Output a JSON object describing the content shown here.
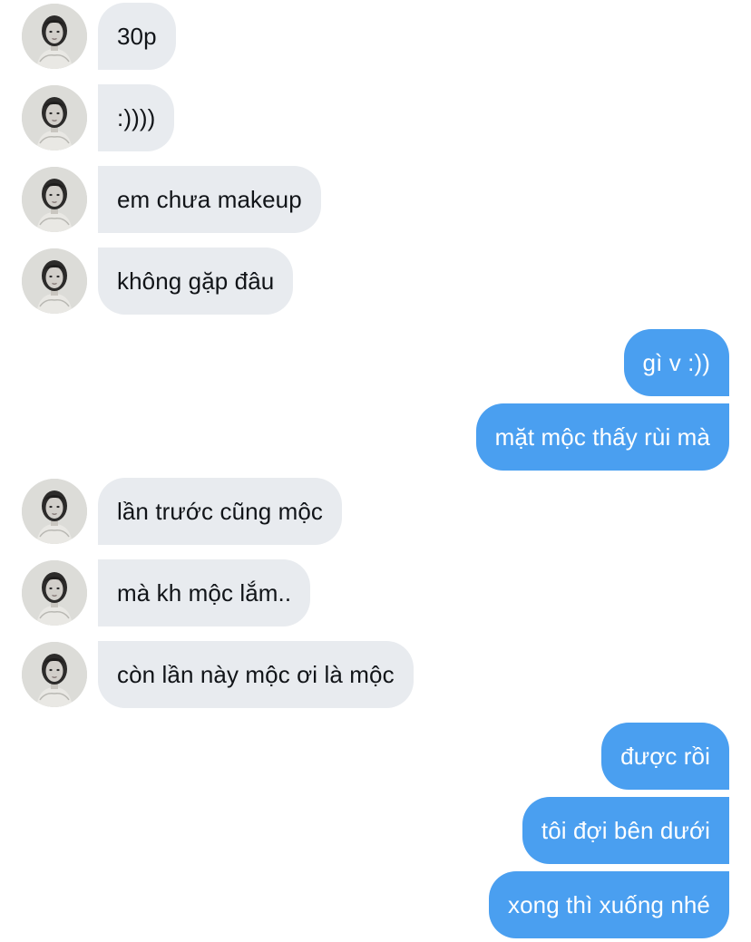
{
  "avatar_icon": "contact-portrait-icon",
  "colors": {
    "incoming_bubble": "#e8ebef",
    "outgoing_bubble": "#4a9ff0",
    "incoming_text": "#111418",
    "outgoing_text": "#ffffff"
  },
  "messages": [
    {
      "sender": "contact",
      "text": "30p"
    },
    {
      "sender": "contact",
      "text": ":))))"
    },
    {
      "sender": "contact",
      "text": "em chưa makeup"
    },
    {
      "sender": "contact",
      "text": "không gặp đâu"
    },
    {
      "sender": "me",
      "text": "gì v :))"
    },
    {
      "sender": "me",
      "text": "mặt mộc thấy rùi mà"
    },
    {
      "sender": "contact",
      "text": "lần trước cũng mộc"
    },
    {
      "sender": "contact",
      "text": "mà kh mộc lắm.."
    },
    {
      "sender": "contact",
      "text": "còn lần này mộc ơi là mộc"
    },
    {
      "sender": "me",
      "text": "được rồi"
    },
    {
      "sender": "me",
      "text": "tôi đợi bên dưới"
    },
    {
      "sender": "me",
      "text": "xong thì xuống nhé"
    }
  ]
}
